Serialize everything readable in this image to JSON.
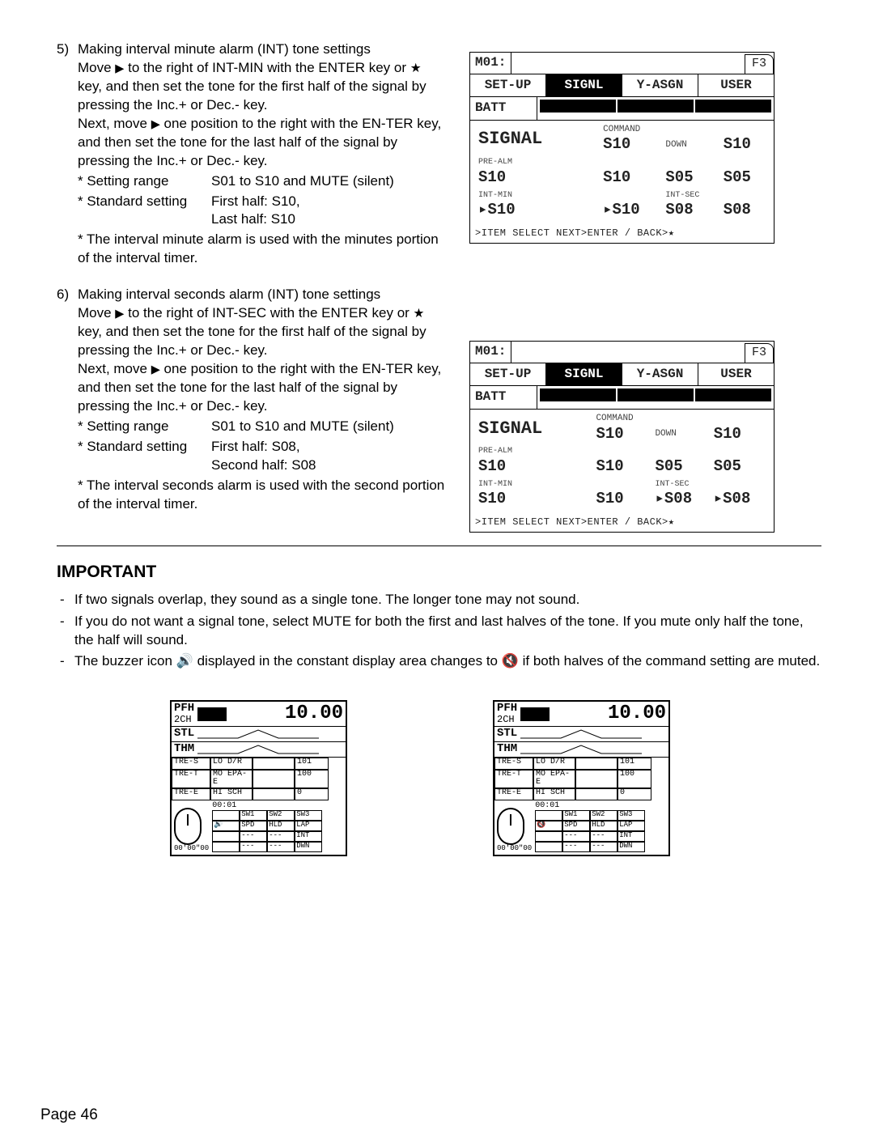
{
  "section5": {
    "num": "5)",
    "title": "Making interval minute alarm (INT) tone settings",
    "p1a": "Move ",
    "p1b": " to the right of INT-MIN with the ENTER key or ",
    "p1c": " key, and then set the tone for the first half of the signal by pressing the Inc.+ or Dec.- key.",
    "p2a": "Next, move ",
    "p2b": " one position to the right with the EN-TER key, and then set the tone for the last half of the signal by pressing the Inc.+ or Dec.- key.",
    "s1_lbl": "* Setting range",
    "s1_val": "S01 to S10 and MUTE (silent)",
    "s2_lbl": "* Standard setting",
    "s2_val1": "First half: S10,",
    "s2_val2": "Last half: S10",
    "s3": "* The interval minute alarm is used with the minutes portion of the interval timer."
  },
  "section6": {
    "num": "6)",
    "title": "Making interval seconds alarm (INT) tone settings",
    "p1a": "Move ",
    "p1b": " to the right of INT-SEC with the ENTER key or ",
    "p1c": " key, and then set the tone for the first half of the signal by pressing the Inc.+ or Dec.- key.",
    "p2a": "Next, move ",
    "p2b": " one position to the right with the EN-TER key, and then set the tone for the last half of the signal by pressing the Inc.+ or Dec.- key.",
    "s1_lbl": "* Setting range",
    "s1_val": "S01 to S10 and MUTE (silent)",
    "s2_lbl": "* Standard setting",
    "s2_val1": "First half: S08,",
    "s2_val2": "Second half: S08",
    "s3": "* The interval seconds alarm is used with the second portion of the interval timer."
  },
  "important": {
    "heading": "IMPORTANT",
    "b1": "If two signals overlap, they sound as a single tone. The longer tone may not sound.",
    "b2": "If you do not want a signal tone, select MUTE for both the first and last halves of the tone. If you mute only half the tone, the half will sound.",
    "b3a": "The buzzer icon ",
    "b3b": " displayed in the constant display area changes to ",
    "b3c": " if both halves of the command setting are muted."
  },
  "lcd1": {
    "title": "M01:",
    "fkey": "F3",
    "tabs": [
      "SET-UP",
      "SIGNL",
      "Y-ASGN",
      "USER"
    ],
    "batt": "BATT",
    "sig": "SIGNAL",
    "hdrCmd": "COMMAND",
    "hdrDown": "DOWN",
    "r1lbl": "PRE-ALM",
    "r1a": "S10",
    "r1b": "S10",
    "r2a": "S10",
    "r2b": "S10",
    "r2c": "S05",
    "r2d": "S05",
    "r3lbl": "INT-MIN",
    "r3a": "▸S10",
    "r3b": "▸S10",
    "r3int": "INT-SEC",
    "r3c": "S08",
    "r3d": "S08",
    "foot": ">ITEM SELECT NEXT>ENTER / BACK>★"
  },
  "lcd2": {
    "title": "M01:",
    "fkey": "F3",
    "tabs": [
      "SET-UP",
      "SIGNL",
      "Y-ASGN",
      "USER"
    ],
    "batt": "BATT",
    "sig": "SIGNAL",
    "hdrCmd": "COMMAND",
    "hdrDown": "DOWN",
    "r1lbl": "PRE-ALM",
    "r1a": "S10",
    "r1b": "S10",
    "r2a": "S10",
    "r2b": "S10",
    "r2c": "S05",
    "r2d": "S05",
    "r3lbl": "INT-MIN",
    "r3a": "S10",
    "r3b": "S10",
    "r3int": "INT-SEC",
    "r3c": "▸S08",
    "r3d": "▸S08",
    "foot": ">ITEM SELECT NEXT>ENTER / BACK>★"
  },
  "small": {
    "pfh": "PFH",
    "ch": "2CH",
    "time": "10.00",
    "stl": "STL",
    "thm": "THM",
    "rows": [
      "TRE-S",
      "TRE-T",
      "TRE-E"
    ],
    "rv1": "LO D/R",
    "rv2": "MO EPA-E",
    "rv3": "HI SCH",
    "rvR1": "101",
    "rvR2": "100",
    "rvR3": "0",
    "bt_time": "00:01",
    "bt_hdr": [
      "SW1",
      "SW2",
      "SW3"
    ],
    "bt_r1": [
      "SPD",
      "HLD",
      "LAP"
    ],
    "bt_r2": [
      "---",
      "---",
      "INT"
    ],
    "bt_r3": [
      "---",
      "---",
      "DWN"
    ],
    "footer": "00'00\"00"
  },
  "page": "Page 46"
}
